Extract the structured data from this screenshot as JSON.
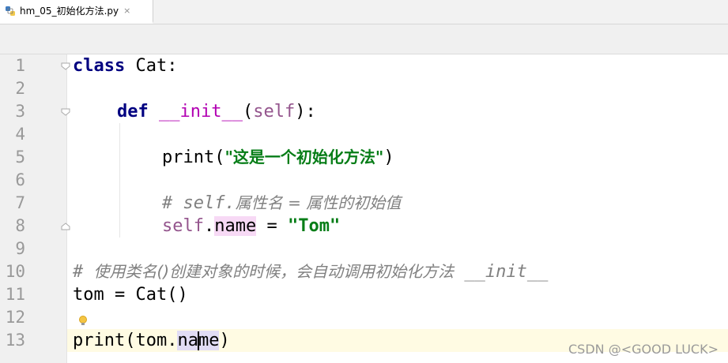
{
  "tab": {
    "filename": "hm_05_初始化方法.py",
    "close_glyph": "×",
    "icon": "python-file-icon"
  },
  "gutter": {
    "line_numbers": [
      "1",
      "2",
      "3",
      "4",
      "5",
      "6",
      "7",
      "8",
      "9",
      "10",
      "11",
      "12",
      "13"
    ]
  },
  "code": {
    "l1_kw": "class",
    "l1_rest": " Cat:",
    "l3_kw": "def",
    "l3_fn": "__init__",
    "l3_open": "(",
    "l3_self": "self",
    "l3_close": "):",
    "l5_print": "print(",
    "l5_str": "\"这是一个初始化方法\"",
    "l5_close": ")",
    "l7_comment_prefix": "# self.",
    "l7_comment_cn": "属性名 = 属性的初始值",
    "l8_self": "self",
    "l8_dot": ".",
    "l8_na": "na",
    "l8_me": "me",
    "l8_eq": " = ",
    "l8_str": "\"Tom\"",
    "l10_comment_prefix": "# ",
    "l10_comment_cn": "使用类名()创建对象的时候，会自动调用初始化方法",
    "l10_comment_suffix": " __init__",
    "l11": "tom = Cat()",
    "l13_a": "print(tom.",
    "l13_na": "na",
    "l13_me": "me",
    "l13_close": ")"
  },
  "watermark": "CSDN @<GOOD LUCK>",
  "colors": {
    "keyword": "#000080",
    "magic_method": "#b200b2",
    "self": "#94558d",
    "string": "#067d17",
    "comment": "#808080",
    "current_line": "#fffbe3"
  }
}
